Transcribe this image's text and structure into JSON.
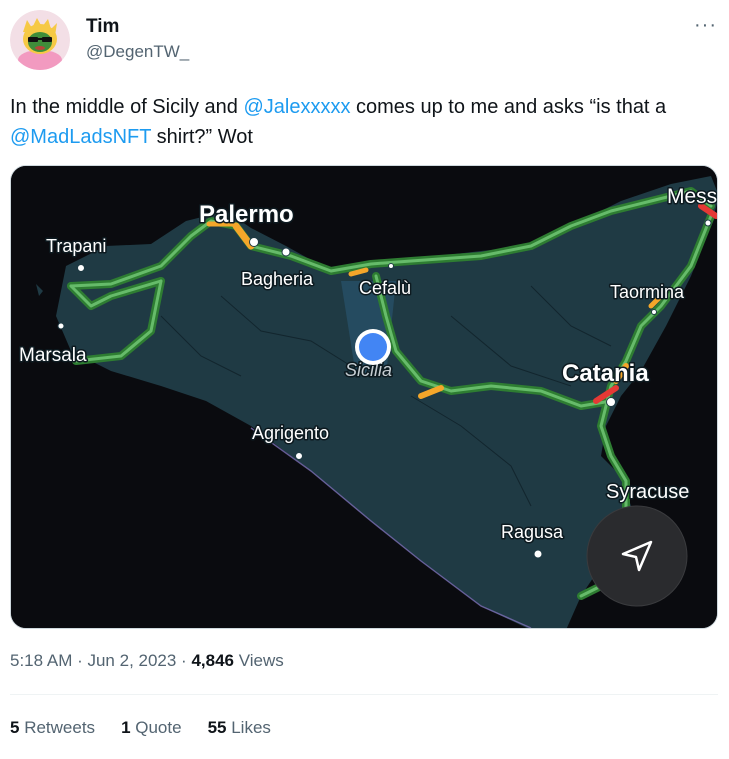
{
  "author": {
    "name": "Tim",
    "handle": "@DegenTW_"
  },
  "more_icon": "ellipsis-icon",
  "tweet": {
    "part1": "In the middle of Sicily and ",
    "mention1": "@Jalexxxxx",
    "part2": " comes up to me and asks “is that a ",
    "mention2": "@MadLadsNFT",
    "part3": " shirt?” Wot"
  },
  "map": {
    "cities": {
      "palermo": "Palermo",
      "trapani": "Trapani",
      "bagheria": "Bagheria",
      "cefalu": "Cefalù",
      "messina": "Mess",
      "taormina": "Taormina",
      "marsala": "Marsala",
      "sicilia": "Sicilia",
      "catania": "Catania",
      "agrigento": "Agrigento",
      "syracuse": "Syracuse",
      "ragusa": "Ragusa"
    },
    "colors": {
      "water": "#0a0b0f",
      "land": "#1f3a44",
      "road": "#4caf50",
      "road_slow": "#f4a62a",
      "road_jam": "#e53935",
      "location_dot": "#4285f4"
    },
    "navigation_icon": "navigation-arrow-icon"
  },
  "meta": {
    "time": "5:18 AM · Jun 2, 2023 · ",
    "views_count": "4,846",
    "views_label": " Views"
  },
  "stats": {
    "retweets_count": "5",
    "retweets_label": " Retweets",
    "quotes_count": "1",
    "quotes_label": " Quote",
    "likes_count": "55",
    "likes_label": " Likes"
  }
}
